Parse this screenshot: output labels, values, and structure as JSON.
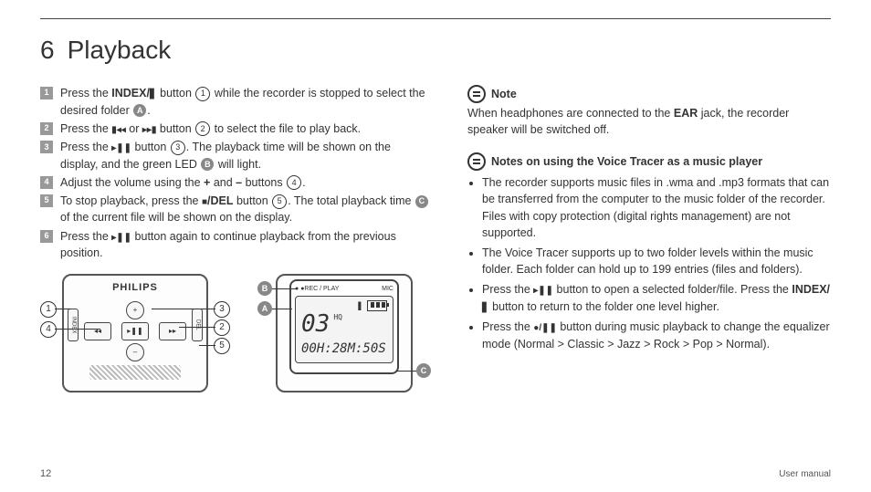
{
  "page": {
    "section_number": "6",
    "section_title": "Playback",
    "page_number": "12",
    "footer": "User manual"
  },
  "steps": [
    {
      "n": "1",
      "pre": "Press the ",
      "bold": "INDEX/",
      "icon": "folder",
      "post_icon": " button ",
      "ref": "1",
      "tail": " while the recorder is stopped to select the desired folder ",
      "letter": "A",
      "end": "."
    },
    {
      "n": "2",
      "pre": "Press the ",
      "icon1": "prev",
      "mid": " or ",
      "icon2": "next",
      "post": " button ",
      "ref": "2",
      "tail": " to select the file to play back."
    },
    {
      "n": "3",
      "pre": "Press the ",
      "icon": "playpause",
      "post": " button ",
      "ref": "3",
      "tail": ". The playback time will be shown on the display, and the green LED ",
      "letter": "B",
      "end": " will light."
    },
    {
      "n": "4",
      "pre": "Adjust the volume using the ",
      "bold1": "+",
      "mid": " and ",
      "bold2": "–",
      "post": " buttons ",
      "ref": "4",
      "end": "."
    },
    {
      "n": "5",
      "pre": "To stop playback, press the ",
      "icon": "stop",
      "bold": "/DEL",
      "post": " button ",
      "ref": "5",
      "tail": ". The total playback time ",
      "letter": "C",
      "end": " of the current file will be shown on the display."
    },
    {
      "n": "6",
      "pre": "Press the ",
      "icon": "playpause",
      "post": " button again to continue playback from the previous position."
    }
  ],
  "diagramA": {
    "brand": "PHILIPS",
    "callouts": {
      "1": "1",
      "4": "4",
      "3": "3",
      "2": "2",
      "5": "5"
    },
    "side_left_top": "INDEX",
    "side_left_bot": "MENU",
    "side_right_top": "REC",
    "side_right_bot": "DEL",
    "keys": {
      "up": "+",
      "down": "–",
      "left": "◂◂",
      "right": "▸▸",
      "center": "▸❚❚"
    }
  },
  "diagramB": {
    "top_left_led": "●REC / PLAY",
    "top_right": "MIC",
    "file_no": "03",
    "quality": "HQ",
    "time": "00H:28M:50S",
    "callouts": {
      "A": "A",
      "B": "B",
      "C": "C"
    }
  },
  "right": {
    "note_heading": "Note",
    "note_text_pre": "When headphones are connected to the ",
    "note_bold": "EAR",
    "note_text_post": " jack, the recorder speaker will be switched off.",
    "notes2_heading": "Notes on using the Voice Tracer as a music player",
    "bullets": [
      "The recorder supports music files in .wma and .mp3 formats that can be transferred from the computer to the music folder of the recorder. Files with copy protection (digital rights management) are not supported.",
      "The Voice Tracer supports up to two folder levels within the music folder. Each folder can hold up to 199 entries (files and folders)."
    ],
    "bullet3": {
      "pre": "Press the ",
      "icon": "playpause",
      "mid": " button to open a selected folder/file. Press the ",
      "bold": "INDEX/",
      "icon2": "folder",
      "post": " button to return to the folder one level higher."
    },
    "bullet4": {
      "pre": "Press the ",
      "icon": "recpause",
      "post": " button during music playback to change the equalizer mode (Normal > Classic > Jazz > Rock > Pop > Normal)."
    }
  }
}
